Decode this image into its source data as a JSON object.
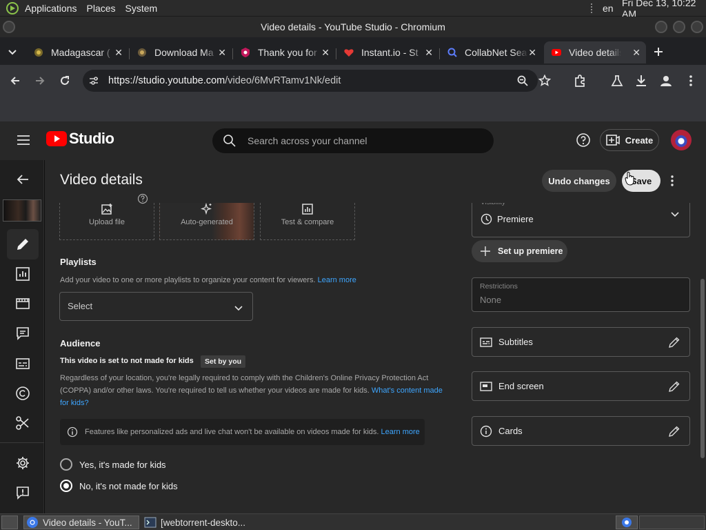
{
  "system_panel": {
    "menus": [
      "Applications",
      "Places",
      "System"
    ],
    "lang": "en",
    "clock": "Fri Dec 13, 10:22 AM"
  },
  "window": {
    "title": "Video details - YouTube Studio - Chromium"
  },
  "tabs": [
    {
      "title": "Madagascar (",
      "icon": "madagascar-favicon"
    },
    {
      "title": "Download Ma",
      "icon": "download-favicon"
    },
    {
      "title": "Thank you for",
      "icon": "shield-heart-favicon"
    },
    {
      "title": "Instant.io - St",
      "icon": "heart-favicon"
    },
    {
      "title": "CollabNet Sea",
      "icon": "magnifier-favicon"
    },
    {
      "title": "Video details",
      "icon": "youtube-favicon",
      "active": true
    }
  ],
  "omnibox": {
    "url_domain": "https://studio.youtube.com",
    "url_path": "/video/6MvRTamv1Nk/edit"
  },
  "studio_header": {
    "logo_text": "Studio",
    "search_placeholder": "Search across your channel",
    "create_label": "Create"
  },
  "page": {
    "title": "Video details",
    "undo_label": "Undo changes",
    "save_label": "Save",
    "thumbnail_options": [
      "Upload file",
      "Auto-generated",
      "Test & compare"
    ],
    "playlists": {
      "heading": "Playlists",
      "description": "Add your video to one or more playlists to organize your content for viewers.",
      "learn_more": "Learn more",
      "select_value": "Select"
    },
    "audience": {
      "heading": "Audience",
      "status": "This video is set to not made for kids",
      "badge": "Set by you",
      "body": "Regardless of your location, you're legally required to comply with the Children's Online Privacy Protection Act (COPPA) and/or other laws. You're required to tell us whether your videos are made for kids.",
      "body_link": "What's content made for kids?",
      "info": "Features like personalized ads and live chat won't be available on videos made for kids.",
      "info_link": "Learn more",
      "options": [
        {
          "label": "Yes, it's made for kids",
          "selected": false
        },
        {
          "label": "No, it's not made for kids",
          "selected": true
        }
      ]
    },
    "right": {
      "visibility_label": "Visibility",
      "visibility_value": "Premiere",
      "set_up_premiere": "Set up premiere",
      "restrictions_label": "Restrictions",
      "restrictions_value": "None",
      "subtitles": "Subtitles",
      "end_screen": "End screen",
      "cards": "Cards"
    }
  },
  "taskbar": {
    "items": [
      "Video details - YouT...",
      "[webtorrent-deskto..."
    ]
  },
  "colors": {
    "youtube_red": "#ff0000",
    "link_blue": "#3ea6ff",
    "panel_bg": "#282828"
  }
}
